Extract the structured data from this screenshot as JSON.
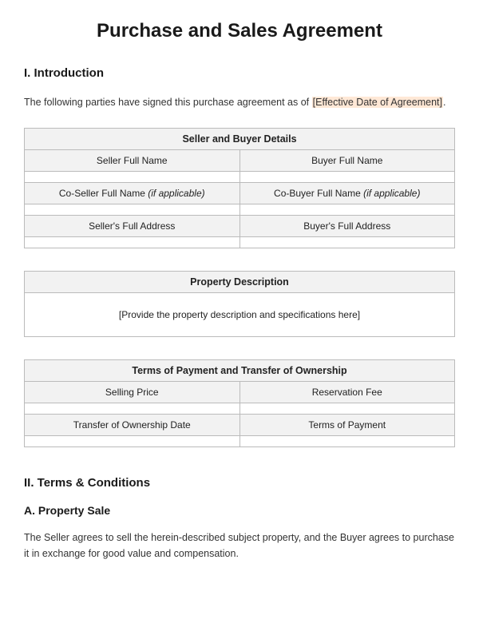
{
  "title": "Purchase and Sales Agreement",
  "section1": {
    "heading": "I. Introduction",
    "intro_text_before": "The following parties have signed this purchase agreement as of ",
    "intro_placeholder": "[Effective Date of Agreement]",
    "intro_text_after": "."
  },
  "table1": {
    "title": "Seller and Buyer Details",
    "seller_name_label": "Seller Full Name",
    "buyer_name_label": "Buyer Full Name",
    "coseller_label_prefix": "Co-Seller Full Name ",
    "coseller_label_suffix": "(if applicable)",
    "cobuyer_label_prefix": "Co-Buyer Full Name ",
    "cobuyer_label_suffix": "(if applicable)",
    "seller_address_label": "Seller's Full Address",
    "buyer_address_label": "Buyer's Full Address"
  },
  "table2": {
    "title": "Property Description",
    "placeholder": "[Provide the property description and specifications here]"
  },
  "table3": {
    "title": "Terms of Payment and Transfer of Ownership",
    "selling_price_label": "Selling Price",
    "reservation_fee_label": "Reservation Fee",
    "transfer_date_label": "Transfer of Ownership Date",
    "terms_payment_label": "Terms of Payment"
  },
  "section2": {
    "heading": "II. Terms & Conditions",
    "subheading": "A. Property Sale",
    "body": "The Seller agrees to sell the herein-described subject property, and the Buyer agrees to purchase it in exchange for good value and compensation."
  }
}
